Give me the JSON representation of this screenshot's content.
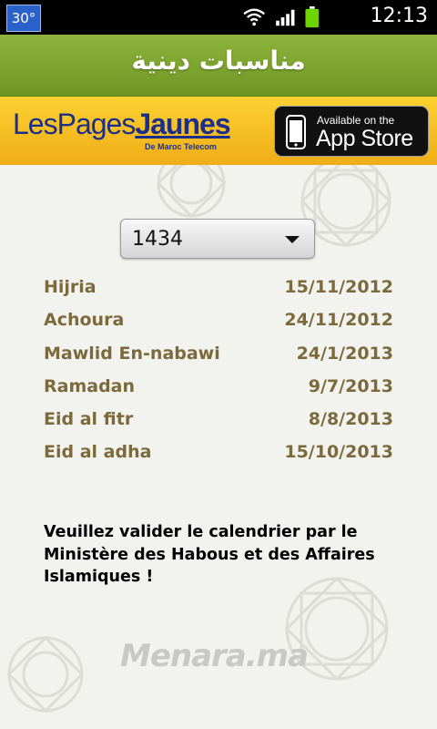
{
  "status_bar": {
    "temperature": "30°",
    "time": "12:13",
    "icons": [
      "wifi-icon",
      "signal-icon",
      "battery-icon"
    ],
    "battery_color": "#6dd400"
  },
  "header": {
    "title": "مناسبات دينية",
    "color": "#7ea32f"
  },
  "banner": {
    "left_logo": {
      "text_les": "Les",
      "text_pages": "Pages",
      "text_jaunes": "Jaunes",
      "subtitle": "De Maroc Telecom"
    },
    "app_store": {
      "available": "Available on the",
      "name": "App Store"
    },
    "color": "#f7c21e"
  },
  "year_selector": {
    "selected": "1434"
  },
  "events": [
    {
      "name": "Hijria",
      "date": "15/11/2012"
    },
    {
      "name": "Achoura",
      "date": "24/11/2012"
    },
    {
      "name": "Mawlid En-nabawi",
      "date": "24/1/2013"
    },
    {
      "name": "Ramadan",
      "date": "9/7/2013"
    },
    {
      "name": "Eid al fitr",
      "date": "8/8/2013"
    },
    {
      "name": "Eid al adha",
      "date": "15/10/2013"
    }
  ],
  "notice": "Veuillez valider le calendrier par le Ministère des Habous et des Affaires Islamiques !",
  "footer": {
    "logo": "Menara.ma"
  },
  "colors": {
    "event_text": "#7c6a3c",
    "background": "#f2f2ee"
  }
}
